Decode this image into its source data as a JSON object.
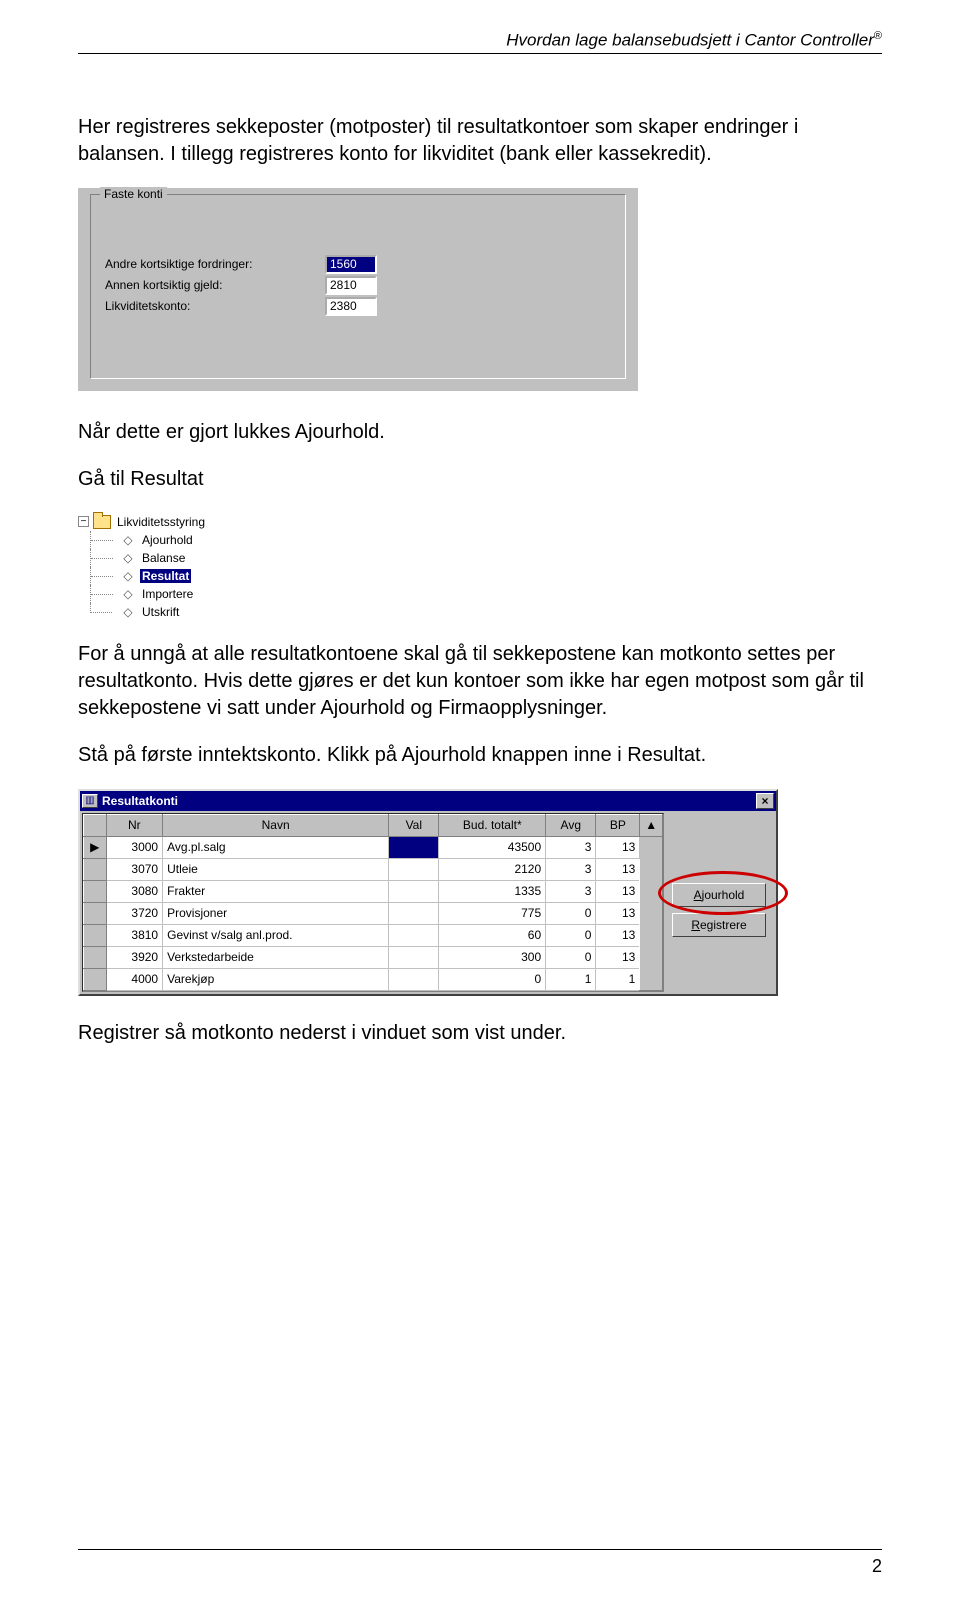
{
  "header": "Hvordan lage balansebudsjett i Cantor Controller",
  "header_reg": "®",
  "p1": "Her registreres sekkeposter (motposter) til resultatkontoer som skaper endringer i balansen. I tillegg registreres konto for likviditet (bank eller kassekredit).",
  "faste_konti": {
    "legend": "Faste konti",
    "rows": [
      {
        "label": "Andre kortsiktige fordringer:",
        "value": "1560",
        "selected": true
      },
      {
        "label": "Annen kortsiktig gjeld:",
        "value": "2810",
        "selected": false
      },
      {
        "label": "Likviditetskonto:",
        "value": "2380",
        "selected": false
      }
    ]
  },
  "p2": "Når dette er gjort lukkes Ajourhold.",
  "p3": "Gå til Resultat",
  "tree": {
    "root": "Likviditetsstyring",
    "items": [
      {
        "label": "Ajourhold",
        "selected": false
      },
      {
        "label": "Balanse",
        "selected": false
      },
      {
        "label": "Resultat",
        "selected": true
      },
      {
        "label": "Importere",
        "selected": false
      },
      {
        "label": "Utskrift",
        "selected": false
      }
    ]
  },
  "p4": "For å unngå at alle resultatkontoene skal gå til sekkepostene kan motkonto settes per resultatkonto. Hvis dette gjøres er det kun kontoer som ikke har egen motpost som går til sekkepostene vi satt under Ajourhold og Firmaopplysninger.",
  "p5": "Stå på første inntektskonto. Klikk på Ajourhold knappen inne i Resultat.",
  "rk": {
    "title": "Resultatkonti",
    "cols": [
      "Nr",
      "Navn",
      "Val",
      "Bud. totalt*",
      "Avg",
      "BP"
    ],
    "scroll_up": "▲",
    "rows": [
      {
        "marker": "▶",
        "nr": "3000",
        "navn": "Avg.pl.salg",
        "val_sel": true,
        "bud": "43500",
        "avg": "3",
        "bp": "13"
      },
      {
        "marker": "",
        "nr": "3070",
        "navn": "Utleie",
        "bud": "2120",
        "avg": "3",
        "bp": "13"
      },
      {
        "marker": "",
        "nr": "3080",
        "navn": "Frakter",
        "bud": "1335",
        "avg": "3",
        "bp": "13"
      },
      {
        "marker": "",
        "nr": "3720",
        "navn": "Provisjoner",
        "bud": "775",
        "avg": "0",
        "bp": "13"
      },
      {
        "marker": "",
        "nr": "3810",
        "navn": "Gevinst v/salg anl.prod.",
        "bud": "60",
        "avg": "0",
        "bp": "13"
      },
      {
        "marker": "",
        "nr": "3920",
        "navn": "Verkstedarbeide",
        "bud": "300",
        "avg": "0",
        "bp": "13"
      },
      {
        "marker": "",
        "nr": "4000",
        "navn": "Varekjøp",
        "bud": "0",
        "avg": "1",
        "bp": "1"
      }
    ],
    "buttons": {
      "ajourhold": "Ajourhold",
      "registrere": "Registrere"
    }
  },
  "p6": "Registrer så motkonto nederst i vinduet som vist under.",
  "page_number": "2"
}
